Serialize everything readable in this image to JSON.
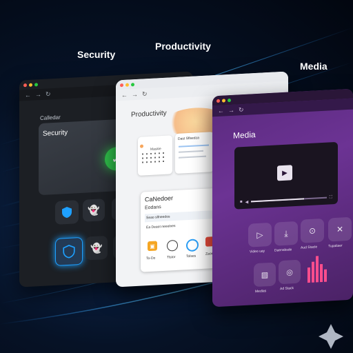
{
  "labels": {
    "security": "Security",
    "productivity": "Productivity",
    "media": "Media"
  },
  "security_window": {
    "sidebar_text": "Calledar",
    "card_title": "Security"
  },
  "productivity_window": {
    "title": "Productivity",
    "mini_card_title": "Maskie",
    "mini_card2_title": "Dast Sflsedza",
    "list_title": "CaNedoer",
    "list_subtitle": "Eodans",
    "list_rows": [
      "Seao slfneedos",
      "Ea Deaot neeelnes"
    ],
    "apps": [
      {
        "label": "To-Do",
        "icon": "todo-icon"
      },
      {
        "label": "Tlstor",
        "icon": "clock-icon"
      },
      {
        "label": "Tolses",
        "icon": "ring-icon"
      },
      {
        "label": "Zaoep",
        "icon": "note-icon"
      }
    ]
  },
  "media_window": {
    "title": "Media",
    "tiles": [
      {
        "label": "Video uay",
        "icon": "video-icon"
      },
      {
        "label": "Daensbsde",
        "icon": "download-icon"
      },
      {
        "label": "Aud Stacle",
        "icon": "audio-icon"
      },
      {
        "label": "Tupaliaer",
        "icon": "tools-icon"
      },
      {
        "label": "Medlas",
        "icon": "photo-icon"
      },
      {
        "label": "Ad Stack",
        "icon": "stack-icon"
      },
      {
        "label": "",
        "icon": "equalizer-icon"
      }
    ]
  },
  "colors": {
    "accent_green": "#2fbf4a",
    "accent_blue": "#1ea0ff",
    "media_purple": "#6c3394"
  }
}
